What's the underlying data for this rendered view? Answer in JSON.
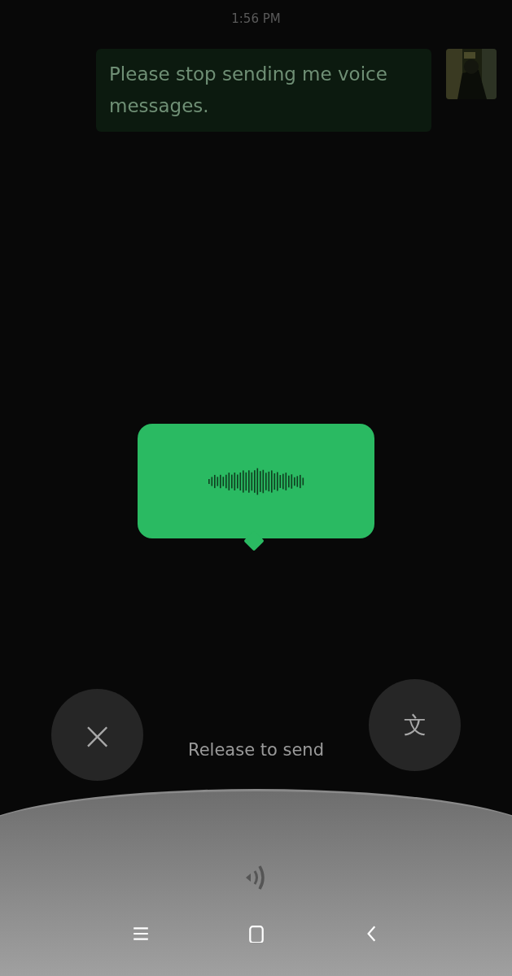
{
  "timestamp": "1:56 PM",
  "messages": [
    {
      "text": "Please stop sending me voice messages."
    }
  ],
  "recording": {
    "kind": "voice"
  },
  "cancel_button": {
    "label": "×"
  },
  "translate_button": {
    "label": "文"
  },
  "hint": "Release to send",
  "nav_bar": [
    {
      "kind": "menu"
    },
    {
      "kind": "home"
    },
    {
      "kind": "back"
    }
  ]
}
